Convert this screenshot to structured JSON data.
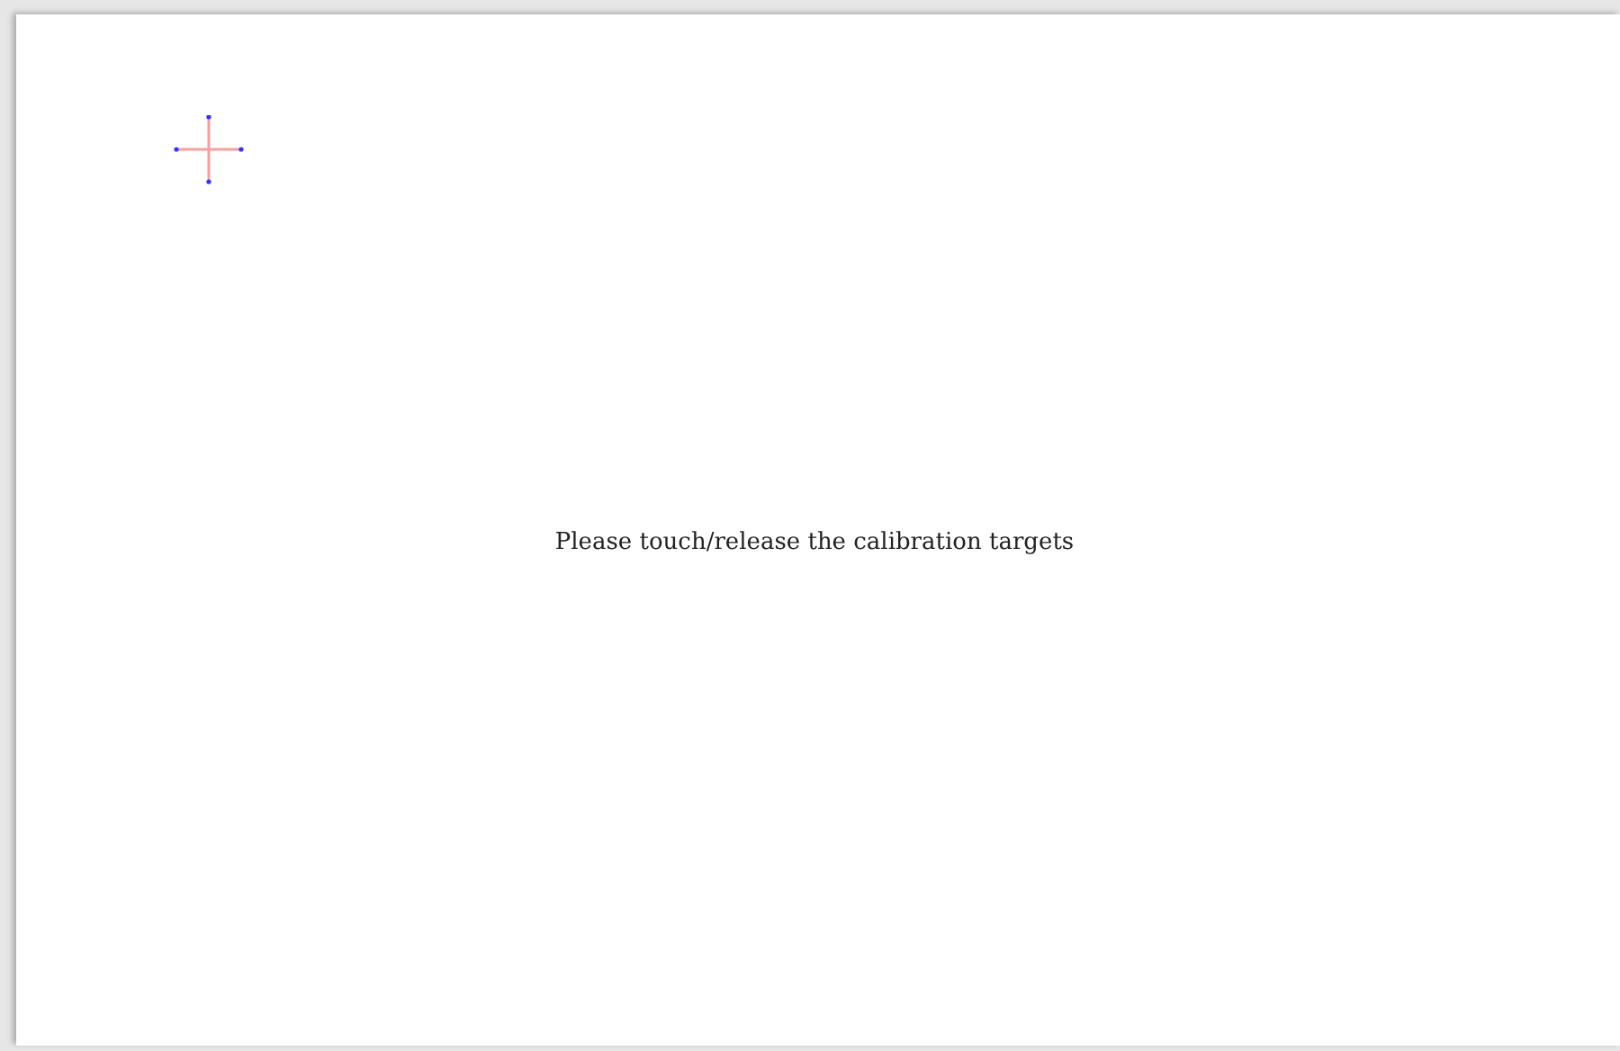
{
  "calibration": {
    "instruction": "Please touch/release the calibration targets"
  }
}
